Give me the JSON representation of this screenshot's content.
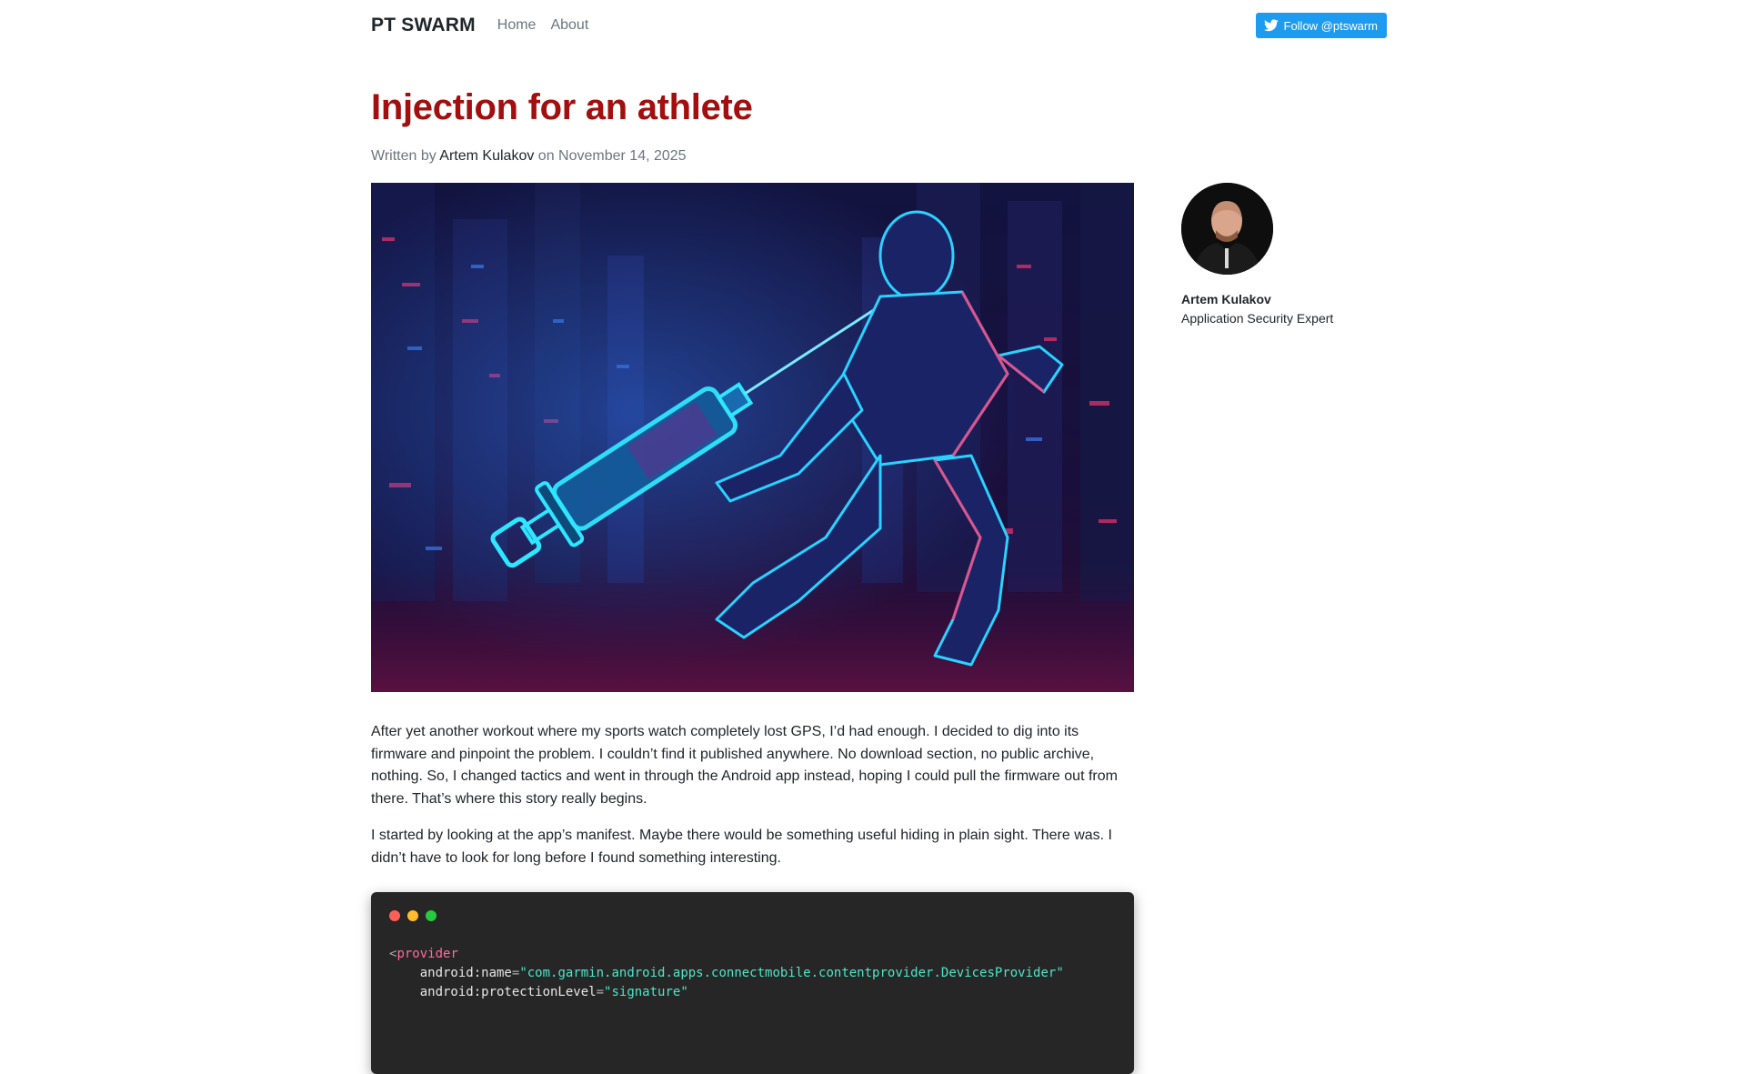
{
  "header": {
    "brand": "PT SWARM",
    "nav": [
      "Home",
      "About"
    ],
    "follow_label": "Follow @ptswarm"
  },
  "post": {
    "title": "Injection for an athlete",
    "byline_prefix": "Written by",
    "author": "Artem Kulakov",
    "date_prefix": "on",
    "date": "November 14, 2025",
    "paragraphs": [
      "After yet another workout where my sports watch completely lost GPS, I’d had enough. I decided to dig into its firmware and pinpoint the problem. I couldn’t find it published anywhere. No download section, no public archive, nothing. So, I changed tactics and went in through the Android app instead, hoping I could pull the firmware out from there. That’s where this story really begins.",
      "I started by looking at the app’s manifest. Maybe there would be something useful hiding in plain sight. There was. I didn’t have to look for long before I found something interesting."
    ]
  },
  "code": {
    "line1_tag": "provider",
    "line2_attr": "android:name",
    "line2_val": "\"com.garmin.android.apps.connectmobile.contentprovider.DevicesProvider\"",
    "line3_attr": "android:protectionLevel",
    "line3_val": "\"signature\""
  },
  "sidebar": {
    "name": "Artem Kulakov",
    "role": "Application Security Expert"
  },
  "colors": {
    "title": "#a30e0e",
    "twitter_blue": "#1d9bf0",
    "code_bg": "#262626"
  },
  "icons": [
    "twitter-bird-icon"
  ]
}
